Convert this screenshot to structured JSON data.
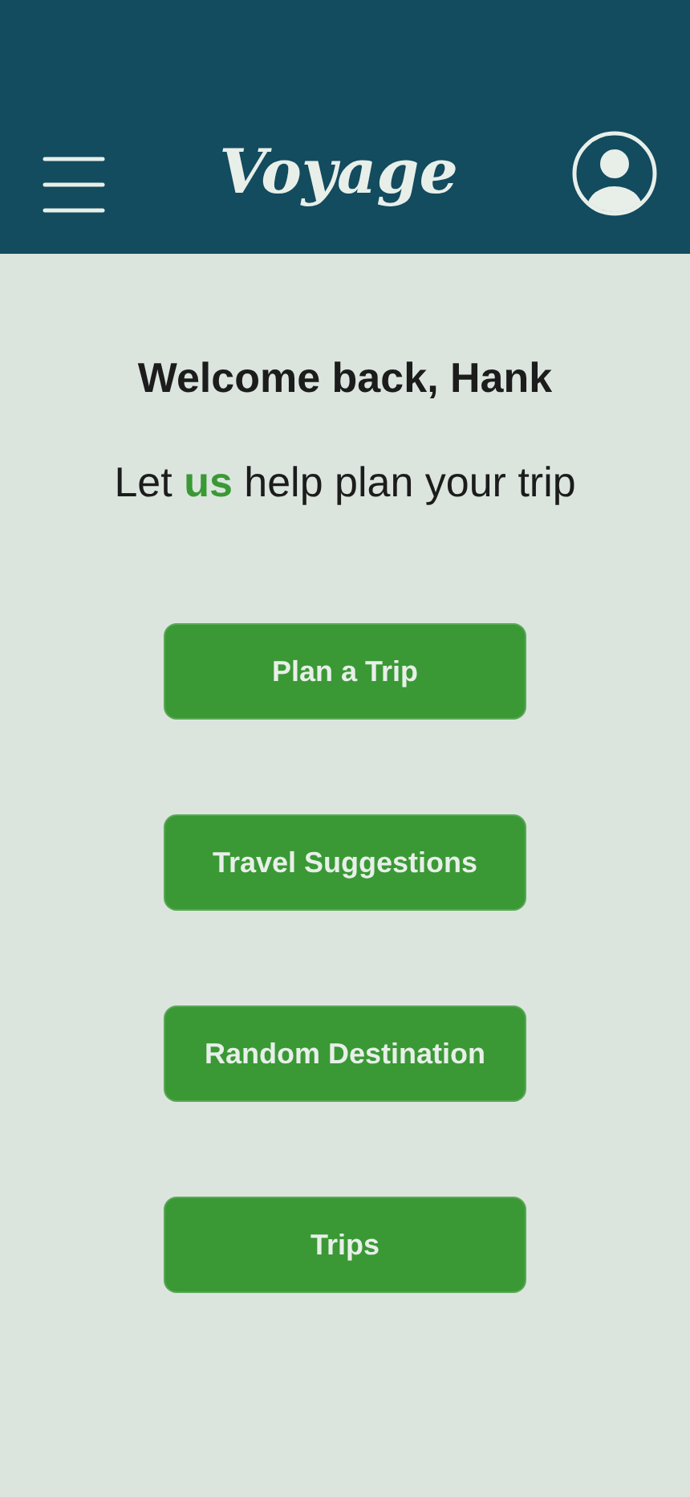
{
  "header": {
    "logo": "Voyage"
  },
  "greeting": "Welcome back, Hank",
  "tagline": "Let **us** help plan your trip",
  "buttons": [
    "Plan a Trip",
    "Travel Suggestions",
    "Random Destination",
    "Trips"
  ]
}
